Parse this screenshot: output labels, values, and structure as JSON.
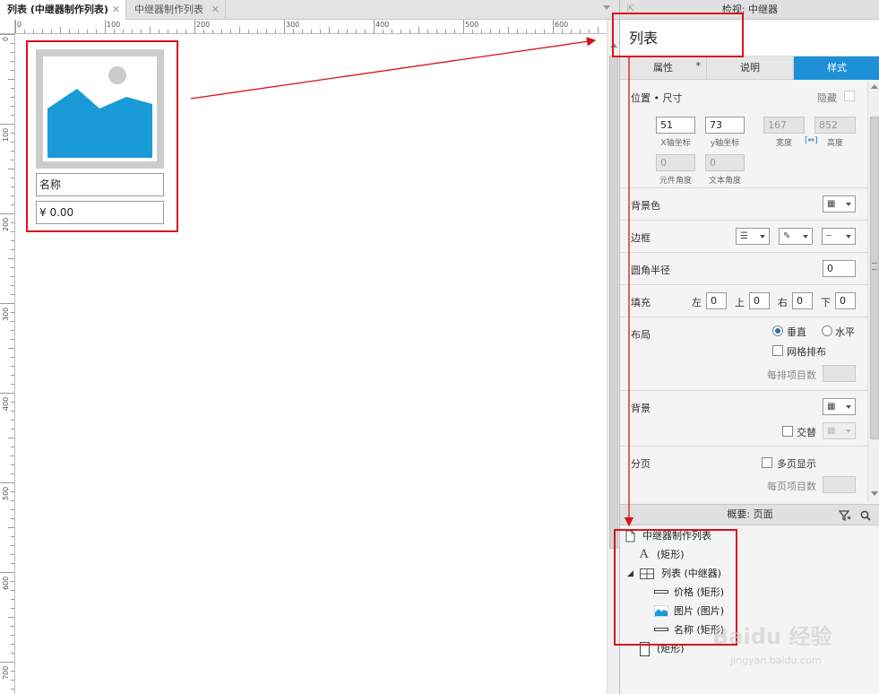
{
  "tabs": [
    {
      "label": "列表 (中继器制作列表)",
      "active": true
    },
    {
      "label": "中继器制作列表",
      "active": false
    }
  ],
  "close_glyph": "✕",
  "ruler": {
    "h_labels": [
      "0",
      "100",
      "200",
      "300",
      "400",
      "500",
      "600"
    ],
    "v_labels": [
      "0",
      "100",
      "200",
      "300",
      "400",
      "500",
      "600",
      "700"
    ]
  },
  "repeater": {
    "name_field": "名称",
    "price_field": "¥ 0.00"
  },
  "inspector": {
    "title": "检视: 中继器",
    "widget_name": "列表",
    "tabs": [
      {
        "label": "属性",
        "active": false,
        "marker": "*"
      },
      {
        "label": "说明",
        "active": false
      },
      {
        "label": "样式",
        "active": true
      }
    ],
    "position_size": {
      "label": "位置 • 尺寸",
      "hidden_label": "隐藏",
      "x": {
        "value": "51",
        "label": "X轴坐标"
      },
      "y": {
        "value": "73",
        "label": "y轴坐标"
      },
      "width": {
        "value": "167",
        "label": "宽度"
      },
      "height": {
        "value": "852",
        "label": "高度"
      },
      "widget_angle": {
        "value": "0",
        "label": "元件角度"
      },
      "text_angle": {
        "value": "0",
        "label": "文本角度"
      }
    },
    "background_color_label": "背景色",
    "border_label": "边框",
    "corner_radius": {
      "label": "圆角半径",
      "value": "0"
    },
    "padding": {
      "label": "填充",
      "left": {
        "label": "左",
        "value": "0"
      },
      "top": {
        "label": "上",
        "value": "0"
      },
      "right": {
        "label": "右",
        "value": "0"
      },
      "bottom": {
        "label": "下",
        "value": "0"
      }
    },
    "layout": {
      "label": "布局",
      "vertical": "垂直",
      "horizontal": "水平",
      "selected": "vertical",
      "grid_label": "网格排布",
      "per_row_label": "每排项目数"
    },
    "background": {
      "label": "背景",
      "alternate_label": "交替"
    },
    "pagination": {
      "label": "分页",
      "multi_page_label": "多页显示",
      "per_page_label": "每页项目数"
    }
  },
  "outline": {
    "title": "概要: 页面",
    "items": [
      {
        "label": "中继器制作列表",
        "icon": "page-icon",
        "level": 0
      },
      {
        "label": "(矩形)",
        "icon": "text-a-icon",
        "level": 1
      },
      {
        "label": "列表 (中继器)",
        "icon": "repeater-icon",
        "level": 1,
        "expanded": true
      },
      {
        "label": "价格 (矩形)",
        "icon": "line-rect-icon",
        "level": 2
      },
      {
        "label": "图片 (图片)",
        "icon": "image-icon",
        "level": 2
      },
      {
        "label": "名称 (矩形)",
        "icon": "line-rect-icon",
        "level": 2
      },
      {
        "label": "(矩形)",
        "icon": "rect-icon",
        "level": 1
      }
    ]
  },
  "watermark": {
    "text": "Baidu 经验",
    "sub": "jingyan.baidu.com"
  },
  "colors": {
    "accent": "#1e90d6",
    "annotation_red": "#d9121b",
    "image_blue": "#1a9bd7",
    "placeholder_gray": "#cccccc"
  }
}
